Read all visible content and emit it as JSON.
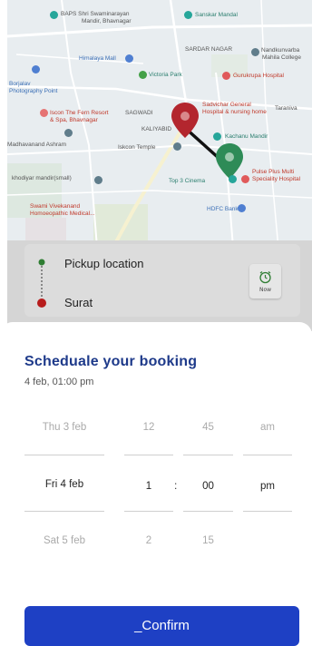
{
  "map": {
    "labels": [
      {
        "id": "baps",
        "text": "BAPS Shri Swaminarayan",
        "cls": "gray"
      },
      {
        "id": "baps2",
        "text": "Mandir, Bhavnagar",
        "cls": "gray"
      },
      {
        "id": "sanskar",
        "text": "Sanskar Mandal",
        "cls": "teal"
      },
      {
        "id": "himalaya",
        "text": "Himalaya Mall",
        "cls": "blue"
      },
      {
        "id": "victoria",
        "text": "Victoria Park",
        "cls": "teal"
      },
      {
        "id": "sardar",
        "text": "SARDAR NAGAR",
        "cls": "gray"
      },
      {
        "id": "nandkunvarba",
        "text": "Nandkunvarba",
        "cls": "gray"
      },
      {
        "id": "mahila",
        "text": "Mahila College",
        "cls": "gray"
      },
      {
        "id": "gurukrupa",
        "text": "Gurukrupa Hospital",
        "cls": "red"
      },
      {
        "id": "borjalav",
        "text": "Borjalav",
        "cls": "blue"
      },
      {
        "id": "photo",
        "text": "Photography Point",
        "cls": "blue"
      },
      {
        "id": "fern",
        "text": "Iscon The Fern Resort",
        "cls": "red"
      },
      {
        "id": "fern2",
        "text": "& Spa, Bhavnagar",
        "cls": "red"
      },
      {
        "id": "sagwadi",
        "text": "SAGWADI",
        "cls": "gray"
      },
      {
        "id": "sadvichar",
        "text": "Sadvichar General",
        "cls": "red"
      },
      {
        "id": "sadvichar2",
        "text": "Hospital & nursing home",
        "cls": "red"
      },
      {
        "id": "taranivya",
        "text": "Taraniva",
        "cls": "gray"
      },
      {
        "id": "kaliyabid",
        "text": "KALIYABID",
        "cls": "gray"
      },
      {
        "id": "madhavanand",
        "text": "Madhavanand Ashram",
        "cls": "gray"
      },
      {
        "id": "iskcon",
        "text": "Iskcon Temple",
        "cls": "gray"
      },
      {
        "id": "kachanu",
        "text": "Kachanu Mandir",
        "cls": "teal"
      },
      {
        "id": "khodiyar",
        "text": "khodiyar mandir(small)",
        "cls": "gray"
      },
      {
        "id": "top3",
        "text": "Top 3 Cinema",
        "cls": "teal"
      },
      {
        "id": "pulse",
        "text": "Pulse Plus Multi",
        "cls": "red"
      },
      {
        "id": "pulse2",
        "text": "Speciality Hospital",
        "cls": "red"
      },
      {
        "id": "swami",
        "text": "Swami Vivekanand",
        "cls": "red"
      },
      {
        "id": "swami2",
        "text": "Homoeopathic Medical...",
        "cls": "red"
      },
      {
        "id": "hdfc",
        "text": "HDFC Bank",
        "cls": "blue"
      }
    ]
  },
  "locations": {
    "pickup": "Pickup location",
    "dropoff": "Surat",
    "now_label": "Now"
  },
  "booking": {
    "title": "Scheduale your booking",
    "subtitle": "4 feb, 01:00 pm",
    "rows": [
      {
        "day": "Thu 3 feb",
        "hour": "12",
        "minute": "45",
        "period": "am"
      },
      {
        "day": "Fri 4 feb",
        "hour": "1",
        "minute": "00",
        "period": "pm"
      },
      {
        "day": "Sat 5 feb",
        "hour": "2",
        "minute": "15",
        "period": ""
      }
    ],
    "separator": ":",
    "confirm": "_Confirm"
  },
  "colors": {
    "accent": "#1e40c4",
    "title": "#1e3a8a",
    "pickup_dot": "#2e7d32",
    "dropoff_dot": "#b71c1c",
    "red_pin": "#b3262e",
    "green_pin": "#2e8b57"
  }
}
